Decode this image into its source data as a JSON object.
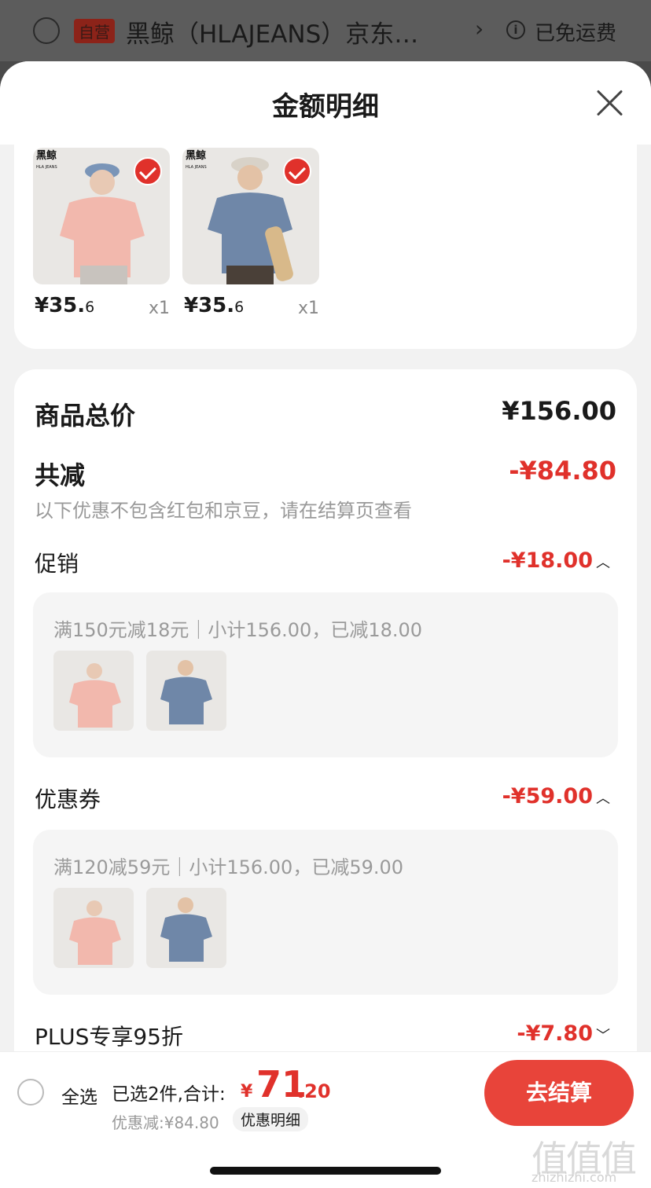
{
  "shop_header": {
    "badge": "自营",
    "shop_name": "黑鲸（HLAJEANS）京东…",
    "free_shipping": "已免运费"
  },
  "sheet": {
    "title": "金额明细"
  },
  "products": [
    {
      "price_int": "¥35.",
      "price_dec": "6",
      "qty": "x1",
      "brand": "黑鲸",
      "brand_sub": "HLA JEANS",
      "color": "pink",
      "checked": true
    },
    {
      "price_int": "¥35.",
      "price_dec": "6",
      "qty": "x1",
      "brand": "黑鲸",
      "brand_sub": "HLA JEANS",
      "color": "blue",
      "checked": true
    }
  ],
  "summary": {
    "total_label": "商品总价",
    "total_value": "¥156.00",
    "reduce_label": "共减",
    "reduce_value": "-¥84.80",
    "note": "以下优惠不包含红包和京豆，请在结算页查看"
  },
  "sections": [
    {
      "label": "促销",
      "value": "-¥18.00",
      "chevron": "chevron-up-icon",
      "detail": "满150元减18元｜小计156.00，已减18.00"
    },
    {
      "label": "优惠券",
      "value": "-¥59.00",
      "chevron": "chevron-up-icon",
      "detail": "满120减59元｜小计156.00，已减59.00"
    },
    {
      "label": "PLUS专享95折",
      "value": "-¥7.80",
      "chevron": "chevron-down-icon"
    }
  ],
  "bottom": {
    "select_all": "全选",
    "selected": "已选2件,合计:",
    "total_yen": "¥",
    "total_int": "71",
    "total_dec": ".20",
    "discount": "优惠减:¥84.80",
    "detail_link": "优惠明细",
    "checkout": "去结算"
  },
  "watermark": {
    "text": "值值值",
    "url": "zhizhizhi.com"
  },
  "colors": {
    "accent": "#e0312b",
    "checkout": "#e8443a",
    "pink_shirt": "#f2b8ad",
    "blue_shirt": "#6f87a8"
  }
}
